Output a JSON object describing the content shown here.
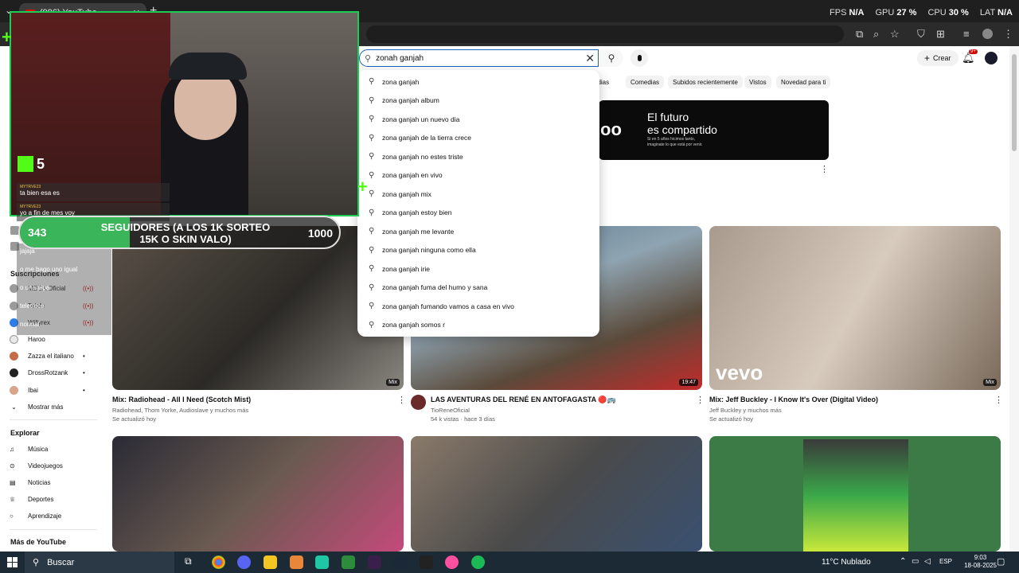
{
  "browser": {
    "tab_title": "(996) YouTube",
    "tab_close": "✕",
    "new_tab": "+"
  },
  "perf": {
    "fps_label": "FPS",
    "fps_value": "N/A",
    "gpu_label": "GPU",
    "gpu_value": "27 %",
    "cpu_label": "CPU",
    "cpu_value": "30 %",
    "lat_label": "LAT",
    "lat_value": "N/A"
  },
  "youtube": {
    "search_value": "zonah ganjah",
    "create_label": "Crear",
    "notif_badge": "9+",
    "chips": [
      "Comedias",
      "Subidos recientemente",
      "Vistos",
      "Novedad para ti"
    ],
    "chip_partial": "edias",
    "suggestions": [
      "zona ganjah",
      "zona ganjah album",
      "zona ganjah un nuevo dia",
      "zona ganjah de la tierra crece",
      "zona ganjah no estes triste",
      "zona ganjah en vivo",
      "zona ganjah mix",
      "zona ganjah estoy bien",
      "zona ganjah me levante",
      "zona ganjah ninguna como ella",
      "zona ganjah irie",
      "zona ganjah fuma del humo y sana",
      "zona ganjah fumando vamos a casa en vivo",
      "zona ganjah somos r"
    ],
    "banner": {
      "logo": "oo",
      "headline_1": "El futuro",
      "headline_2": "es compartido",
      "sub_1": "Si en 5 años hicimos tanto,",
      "sub_2": "imaginate lo que está por venir."
    }
  },
  "sidebar": {
    "subs_heading": "Suscripciones",
    "subs": [
      {
        "name": "MEGA Oficial",
        "live": "((•))"
      },
      {
        "name": "Telefe",
        "live": "((•))"
      },
      {
        "name": "Willyrex",
        "live": "((•))"
      },
      {
        "name": "Haroo",
        "live": ""
      },
      {
        "name": "Zazza el italiano",
        "live": "•"
      },
      {
        "name": "DrossRotzank",
        "live": "•"
      },
      {
        "name": "Ibai",
        "live": "•"
      }
    ],
    "show_more": "Mostrar más",
    "explore_heading": "Explorar",
    "explore": [
      "Música",
      "Videojuegos",
      "Noticias",
      "Deportes",
      "Aprendizaje"
    ],
    "more_heading": "Más de YouTube"
  },
  "videos": [
    {
      "title": "Mix: Radiohead - All I Need (Scotch Mist)",
      "meta1": "Radiohead, Thom Yorke, Audioslave y muchos más",
      "meta2": "Se actualizó hoy",
      "badge": "Mix"
    },
    {
      "title": "LAS AVENTURAS DEL RENÉ EN ANTOFAGASTA 🔴🚌",
      "meta1": "TioReneOficial",
      "meta2": "54 k vistas · hace 3 días",
      "badge": "19:47"
    },
    {
      "title": "Mix: Jeff Buckley - I Know It's Over (Digital Video)",
      "meta1": "Jeff Buckley y muchos más",
      "meta2": "Se actualizó hoy",
      "badge": "Mix",
      "overlay": "vevo"
    }
  ],
  "stream": {
    "viewers": "5",
    "chat": [
      {
        "user": "MYTRVE23",
        "msg": "ta bien esa es"
      },
      {
        "user": "MYTRVE23",
        "msg": "yo a fin de mes voy"
      }
    ],
    "goal_current": "343",
    "goal_text_1": "SEGUIDORES (A LOS 1K SORTEO",
    "goal_text_2": "15K O SKIN VALO)",
    "goal_max": "1000",
    "goal_progress": 0.343,
    "chat2": [
      "jajaja",
      "o me bago uno igual",
      "o una pipa",
      "teletrece",
      "normal"
    ]
  },
  "taskbar": {
    "search_label": "Buscar",
    "weather": "11°C  Nublado",
    "lang": "ESP",
    "time": "9:03",
    "date": "18-08-2025"
  },
  "colors": {
    "accent_blue": "#1c62b9",
    "kick_green": "#53fc18",
    "yt_red": "#ff0000"
  }
}
